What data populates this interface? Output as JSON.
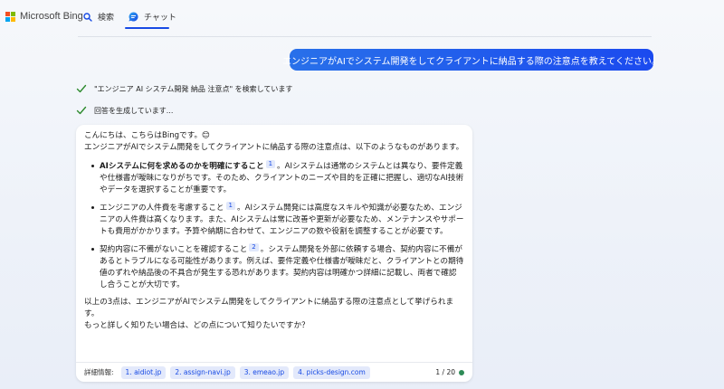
{
  "header": {
    "logo_text": "Microsoft Bing",
    "tabs": [
      {
        "label": "検索",
        "icon": "search-icon"
      },
      {
        "label": "チャット",
        "icon": "chat-icon",
        "active": true
      }
    ],
    "accent_color": "#174ae4"
  },
  "user_message": "エンジニアがAIでシステム開発をしてクライアントに納品する際の注意点を教えてください。",
  "statuses": [
    "\"エンジニア AI システム開発 納品 注意点\" を検索しています",
    "回答を生成しています..."
  ],
  "answer": {
    "greeting": "こんにちは、こちらはBingです。😊",
    "intro": "エンジニアがAIでシステム開発をしてクライアントに納品する際の注意点は、以下のようなものがあります。",
    "points": [
      {
        "lead": "AIシステムに何を求めるのかを明確にすること",
        "cite": "1",
        "body": "。AIシステムは通常のシステムとは異なり、要件定義や仕様書が曖昧になりがちです。そのため、クライアントのニーズや目的を正確に把握し、適切なAI技術やデータを選択することが重要です。"
      },
      {
        "lead": "エンジニアの人件費を考慮すること",
        "cite": "1",
        "body": "。AIシステム開発には高度なスキルや知識が必要なため、エンジニアの人件費は高くなります。また、AIシステムは常に改善や更新が必要なため、メンテナンスやサポートも費用がかかります。予算や納期に合わせて、エンジニアの数や役割を調整することが必要です。"
      },
      {
        "lead": "契約内容に不備がないことを確認すること",
        "cite": "2",
        "body": "。システム開発を外部に依頼する場合、契約内容に不備があるとトラブルになる可能性があります。例えば、要件定義や仕様書が曖昧だと、クライアントとの期待値のずれや納品後の不具合が発生する恐れがあります。契約内容は明確かつ詳細に記載し、両者で確認し合うことが大切です。"
      }
    ],
    "summary": "以上の3点は、エンジニアがAIでシステム開発をしてクライアントに納品する際の注意点として挙げられます。",
    "question": "もっと詳しく知りたい場合は、どの点について知りたいですか？"
  },
  "footer": {
    "label": "詳細情報:",
    "sources": [
      "1. aidiot.jp",
      "2. assign-navi.jp",
      "3. emeao.jp",
      "4. picks-design.com"
    ],
    "counter": "1 / 20",
    "status_color": "#2e8b57"
  }
}
